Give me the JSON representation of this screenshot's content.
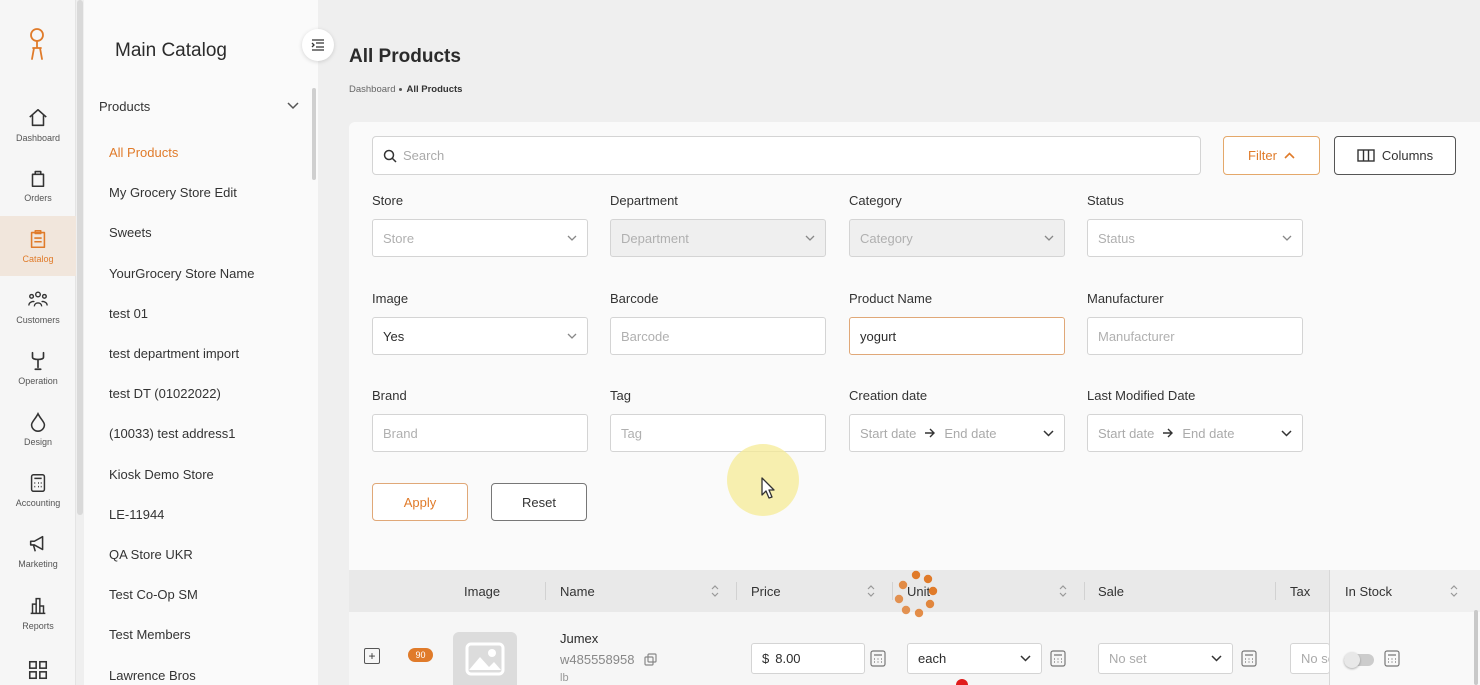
{
  "colors": {
    "accent": "#e07b2a",
    "active_bg": "#f1e6dc"
  },
  "rail": [
    {
      "label": "Dashboard",
      "icon": "home-icon"
    },
    {
      "label": "Orders",
      "icon": "bag-icon"
    },
    {
      "label": "Catalog",
      "icon": "clipboard-icon",
      "active": true
    },
    {
      "label": "Customers",
      "icon": "users-icon"
    },
    {
      "label": "Operation",
      "icon": "wrench-icon"
    },
    {
      "label": "Design",
      "icon": "drop-icon"
    },
    {
      "label": "Accounting",
      "icon": "calculator-icon"
    },
    {
      "label": "Marketing",
      "icon": "megaphone-icon"
    },
    {
      "label": "Reports",
      "icon": "bar-chart-icon"
    },
    {
      "label": "",
      "icon": "grid-icon"
    }
  ],
  "catalog": {
    "title": "Main Catalog",
    "section": "Products",
    "items": [
      "All Products",
      "My Grocery Store Edit",
      "Sweets",
      "YourGrocery Store Name",
      "test 01",
      "test department import",
      "test DT (01022022)",
      "(10033) test address1",
      "Kiosk Demo Store",
      "LE-11944",
      "QA Store UKR",
      "Test Co-Op SM",
      "Test Members",
      "Lawrence Bros"
    ]
  },
  "page": {
    "title": "All Products",
    "breadcrumb": {
      "root": "Dashboard",
      "current": "All Products"
    }
  },
  "toolbar": {
    "search_placeholder": "Search",
    "filter_label": "Filter",
    "columns_label": "Columns"
  },
  "filters": {
    "store": {
      "label": "Store",
      "placeholder": "Store"
    },
    "department": {
      "label": "Department",
      "placeholder": "Department"
    },
    "category": {
      "label": "Category",
      "placeholder": "Category"
    },
    "status": {
      "label": "Status",
      "placeholder": "Status"
    },
    "image": {
      "label": "Image",
      "value": "Yes"
    },
    "barcode": {
      "label": "Barcode",
      "placeholder": "Barcode"
    },
    "product_name": {
      "label": "Product Name",
      "value": "yogurt"
    },
    "manufacturer": {
      "label": "Manufacturer",
      "placeholder": "Manufacturer"
    },
    "brand": {
      "label": "Brand",
      "placeholder": "Brand"
    },
    "tag": {
      "label": "Tag",
      "placeholder": "Tag"
    },
    "creation_date": {
      "label": "Creation date",
      "start": "Start date",
      "end": "End date"
    },
    "modified_date": {
      "label": "Last Modified Date",
      "start": "Start date",
      "end": "End date"
    },
    "apply_label": "Apply",
    "reset_label": "Reset"
  },
  "table": {
    "columns": {
      "image": "Image",
      "name": "Name",
      "price": "Price",
      "unit": "Unit",
      "sale": "Sale",
      "tax": "Tax",
      "in_stock": "In Stock"
    },
    "rows": [
      {
        "badge": "90",
        "name": "Jumex",
        "sku": "w485558958",
        "unit_label": "lb",
        "currency": "$",
        "price": "8.00",
        "unit": "each",
        "sale": "No set",
        "tax": "No se",
        "in_stock": false
      }
    ]
  }
}
